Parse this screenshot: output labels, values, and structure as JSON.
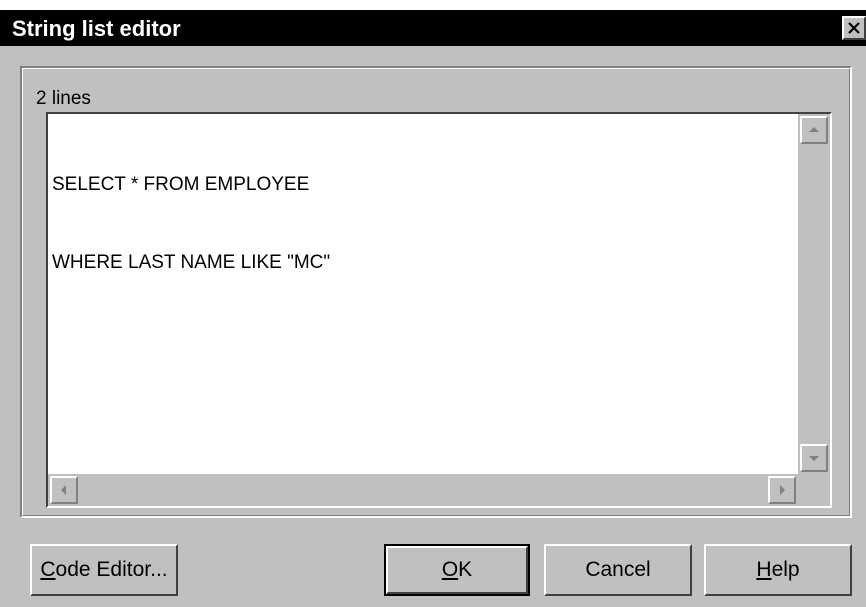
{
  "window": {
    "title": "String list editor"
  },
  "editor": {
    "line_count": "2 lines",
    "lines": [
      "SELECT * FROM EMPLOYEE",
      "WHERE LAST NAME LIKE \"MC\""
    ]
  },
  "buttons": {
    "code_editor": {
      "accel": "C",
      "rest": "ode Editor..."
    },
    "ok": {
      "accel": "O",
      "rest": "K"
    },
    "cancel": {
      "label": "Cancel"
    },
    "help": {
      "accel": "H",
      "rest": "elp"
    }
  },
  "colors": {
    "face": "#c0c0c0",
    "titlebar": "#000000"
  }
}
